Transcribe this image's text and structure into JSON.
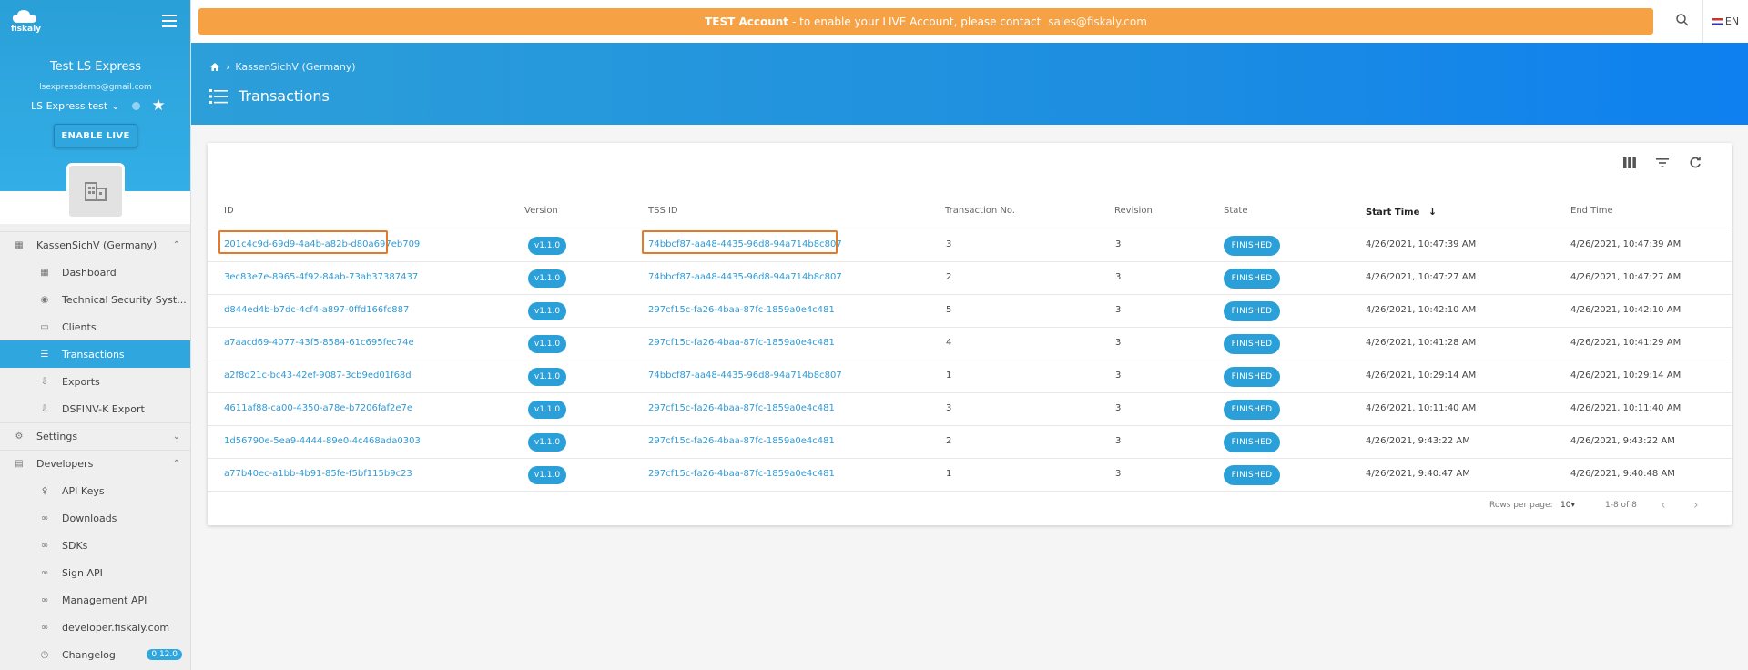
{
  "sidebar": {
    "logo_text": "fiskaly",
    "account_name": "Test LS Express",
    "account_email": "lsexpressdemo@gmail.com",
    "org_selector": "LS Express test",
    "enable_live": "ENABLE LIVE",
    "nav": [
      {
        "label": "KassenSichV (Germany)"
      },
      {
        "label": "Dashboard"
      },
      {
        "label": "Technical Security Syst..."
      },
      {
        "label": "Clients"
      },
      {
        "label": "Transactions"
      },
      {
        "label": "Exports"
      },
      {
        "label": "DSFINV-K Export"
      },
      {
        "label": "Settings"
      },
      {
        "label": "Developers"
      },
      {
        "label": "API Keys"
      },
      {
        "label": "Downloads"
      },
      {
        "label": "SDKs"
      },
      {
        "label": "Sign API"
      },
      {
        "label": "Management API"
      },
      {
        "label": "developer.fiskaly.com"
      },
      {
        "label": "Changelog",
        "badge": "0.12.0"
      }
    ]
  },
  "banner": {
    "bold": "TEST Account",
    "text": "- to enable your LIVE Account, please contact",
    "email": "sales@fiskaly.com"
  },
  "lang": "EN",
  "breadcrumb": "KassenSichV (Germany)",
  "page_title": "Transactions",
  "table": {
    "headers": {
      "id": "ID",
      "version": "Version",
      "tss_id": "TSS ID",
      "tx_no": "Transaction No.",
      "revision": "Revision",
      "state": "State",
      "start": "Start Time",
      "end": "End Time"
    },
    "rows": [
      {
        "id": "201c4c9d-69d9-4a4b-a82b-d80a697eb709",
        "version": "v1.1.0",
        "tss_id": "74bbcf87-aa48-4435-96d8-94a714b8c807",
        "tx_no": "3",
        "revision": "3",
        "state": "FINISHED",
        "start": "4/26/2021, 10:47:39 AM",
        "end": "4/26/2021, 10:47:39 AM"
      },
      {
        "id": "3ec83e7e-8965-4f92-84ab-73ab37387437",
        "version": "v1.1.0",
        "tss_id": "74bbcf87-aa48-4435-96d8-94a714b8c807",
        "tx_no": "2",
        "revision": "3",
        "state": "FINISHED",
        "start": "4/26/2021, 10:47:27 AM",
        "end": "4/26/2021, 10:47:27 AM"
      },
      {
        "id": "d844ed4b-b7dc-4cf4-a897-0ffd166fc887",
        "version": "v1.1.0",
        "tss_id": "297cf15c-fa26-4baa-87fc-1859a0e4c481",
        "tx_no": "5",
        "revision": "3",
        "state": "FINISHED",
        "start": "4/26/2021, 10:42:10 AM",
        "end": "4/26/2021, 10:42:10 AM"
      },
      {
        "id": "a7aacd69-4077-43f5-8584-61c695fec74e",
        "version": "v1.1.0",
        "tss_id": "297cf15c-fa26-4baa-87fc-1859a0e4c481",
        "tx_no": "4",
        "revision": "3",
        "state": "FINISHED",
        "start": "4/26/2021, 10:41:28 AM",
        "end": "4/26/2021, 10:41:29 AM"
      },
      {
        "id": "a2f8d21c-bc43-42ef-9087-3cb9ed01f68d",
        "version": "v1.1.0",
        "tss_id": "74bbcf87-aa48-4435-96d8-94a714b8c807",
        "tx_no": "1",
        "revision": "3",
        "state": "FINISHED",
        "start": "4/26/2021, 10:29:14 AM",
        "end": "4/26/2021, 10:29:14 AM"
      },
      {
        "id": "4611af88-ca00-4350-a78e-b7206faf2e7e",
        "version": "v1.1.0",
        "tss_id": "297cf15c-fa26-4baa-87fc-1859a0e4c481",
        "tx_no": "3",
        "revision": "3",
        "state": "FINISHED",
        "start": "4/26/2021, 10:11:40 AM",
        "end": "4/26/2021, 10:11:40 AM"
      },
      {
        "id": "1d56790e-5ea9-4444-89e0-4c468ada0303",
        "version": "v1.1.0",
        "tss_id": "297cf15c-fa26-4baa-87fc-1859a0e4c481",
        "tx_no": "2",
        "revision": "3",
        "state": "FINISHED",
        "start": "4/26/2021, 9:43:22 AM",
        "end": "4/26/2021, 9:43:22 AM"
      },
      {
        "id": "a77b40ec-a1bb-4b91-85fe-f5bf115b9c23",
        "version": "v1.1.0",
        "tss_id": "297cf15c-fa26-4baa-87fc-1859a0e4c481",
        "tx_no": "1",
        "revision": "3",
        "state": "FINISHED",
        "start": "4/26/2021, 9:40:47 AM",
        "end": "4/26/2021, 9:40:48 AM"
      }
    ]
  },
  "pagination": {
    "rows_per_page_label": "Rows per page:",
    "rows_per_page": "10",
    "range": "1-8 of 8"
  },
  "colors": {
    "accent": "#2a9fd8",
    "banner": "#f6a244",
    "highlight": "#e07b2c"
  }
}
